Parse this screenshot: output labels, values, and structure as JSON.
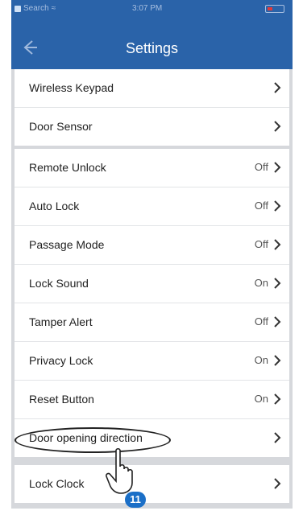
{
  "status_bar": {
    "carrier": "Search",
    "time": "3:07 PM"
  },
  "nav": {
    "title": "Settings"
  },
  "group1": [
    {
      "label": "Wireless Keypad",
      "value": ""
    },
    {
      "label": "Door Sensor",
      "value": ""
    }
  ],
  "group2": [
    {
      "label": "Remote Unlock",
      "value": "Off"
    },
    {
      "label": "Auto Lock",
      "value": "Off"
    },
    {
      "label": "Passage Mode",
      "value": "Off"
    },
    {
      "label": "Lock Sound",
      "value": "On"
    },
    {
      "label": "Tamper Alert",
      "value": "Off"
    },
    {
      "label": "Privacy Lock",
      "value": "On"
    },
    {
      "label": "Reset Button",
      "value": "On"
    },
    {
      "label": "Door opening direction",
      "value": ""
    }
  ],
  "group3": [
    {
      "label": "Lock Clock",
      "value": ""
    }
  ],
  "annotation": {
    "step": "11"
  },
  "colors": {
    "nav_bg": "#2a63a9",
    "badge": "#1b6fc7"
  }
}
